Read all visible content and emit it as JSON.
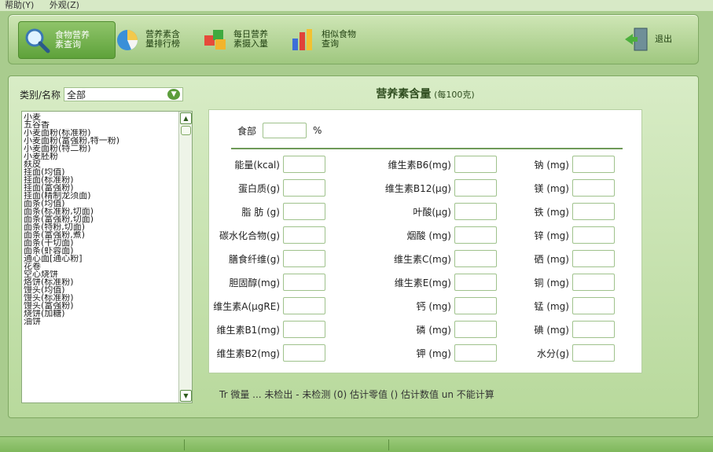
{
  "menu": {
    "help": "帮助(Y)",
    "skin": "外观(Z)"
  },
  "toolbar": {
    "btn1": "食物营养素查询",
    "btn2": "营养素含量排行榜",
    "btn3": "每日营养素摄入量",
    "btn4": "相似食物查询",
    "exit": "退出"
  },
  "category": {
    "label": "类别/名称",
    "value": "全部"
  },
  "foods": [
    "小麦",
    "五谷香",
    "小麦面粉(标准粉)",
    "小麦面粉(富强粉,特一粉)",
    "小麦面粉(特二粉)",
    "小麦胚粉",
    "麸皮",
    "挂面(均值)",
    "挂面(标准粉)",
    "挂面(富强粉)",
    "挂面(精制龙须面)",
    "面条(均值)",
    "面条(标准粉,切面)",
    "面条(富强粉,切面)",
    "面条(特粉,切面)",
    "面条(富强粉,煮)",
    "面条(干切面)",
    "面条(虾蓉面)",
    "通心面[通心粉]",
    "花卷",
    "空心烧饼",
    "烙饼(标准粉)",
    "馒头(均值)",
    "馒头(标准粉)",
    "馒头(富强粉)",
    "烧饼(加糖)",
    "油饼"
  ],
  "nutrition": {
    "title": "营养素含量",
    "subtitle": "(每100克)",
    "edible_label": "食部",
    "edible_unit": "%",
    "col1": [
      "能量(kcal)",
      "蛋白质(g)",
      "脂 肪 (g)",
      "碳水化合物(g)",
      "膳食纤维(g)",
      "胆固醇(mg)",
      "维生素A(μgRE)",
      "维生素B1(mg)",
      "维生素B2(mg)"
    ],
    "col2": [
      "维生素B6(mg)",
      "维生素B12(μg)",
      "叶酸(μg)",
      "烟酸 (mg)",
      "维生素C(mg)",
      "维生素E(mg)",
      "钙 (mg)",
      "磷 (mg)",
      "钾 (mg)"
    ],
    "col3": [
      "钠 (mg)",
      "镁 (mg)",
      "铁 (mg)",
      "锌 (mg)",
      "硒 (mg)",
      "铜 (mg)",
      "锰 (mg)",
      "碘 (mg)",
      "水分(g)"
    ]
  },
  "legend": "Tr 微量  ... 未检出  - 未检测  (0) 估计零值  () 估计数值  un 不能计算"
}
